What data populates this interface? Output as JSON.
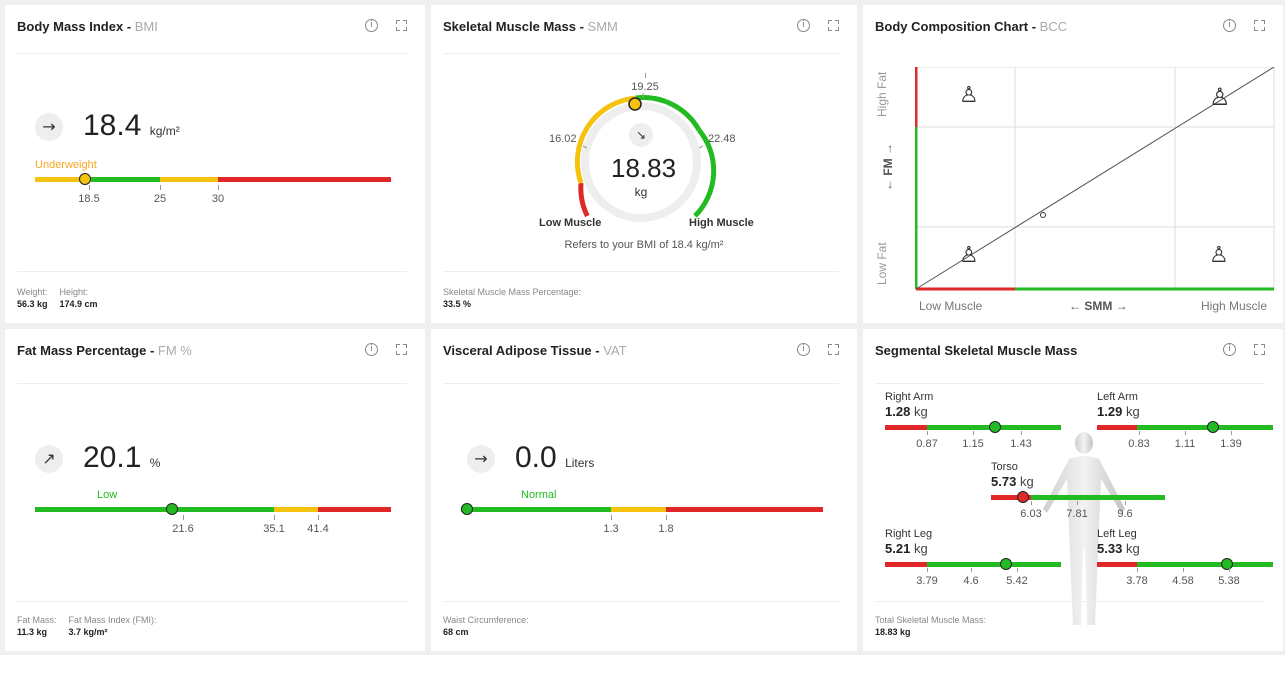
{
  "bmi": {
    "title": "Body Mass Index",
    "abbr": "BMI",
    "trend": "→",
    "value": "18.4",
    "unit": "kg/m²",
    "range_label": "Underweight",
    "ticks": [
      "18.5",
      "25",
      "30"
    ],
    "weight_label": "Weight:",
    "weight": "56.3 kg",
    "height_label": "Height:",
    "height": "174.9 cm",
    "level": 0.14
  },
  "smm": {
    "title": "Skeletal Muscle Mass",
    "abbr": "SMM",
    "value": "18.83",
    "unit": "kg",
    "top": "19.25",
    "left": "16.02",
    "right": "22.48",
    "low_label": "Low Muscle",
    "high_label": "High Muscle",
    "refers": "Refers to your BMI of 18.4 kg/m²",
    "pct_label": "Skeletal Muscle Mass Percentage:",
    "pct": "33.5 %"
  },
  "bcc": {
    "title": "Body Composition Chart",
    "abbr": "BCC",
    "y_high": "High Fat",
    "y_low": "Low Fat",
    "y_axis": "← FM →",
    "x_low": "Low Muscle",
    "x_high": "High Muscle",
    "x_axis": "← SMM →"
  },
  "fm": {
    "title": "Fat Mass Percentage",
    "abbr": "FM %",
    "trend": "↗",
    "value": "20.1",
    "unit": "%",
    "range_label": "Low",
    "ticks": [
      "21.6",
      "35.1",
      "41.4"
    ],
    "mass_label": "Fat Mass:",
    "mass": "11.3 kg",
    "fmi_label": "Fat Mass Index (FMI):",
    "fmi": "3.7 kg/m²"
  },
  "vat": {
    "title": "Visceral Adipose Tissue",
    "abbr": "VAT",
    "trend": "→",
    "value": "0.0",
    "unit": "Liters",
    "range_label": "Normal",
    "ticks": [
      "1.3",
      "1.8"
    ],
    "waist_label": "Waist Circumference:",
    "waist": "68 cm"
  },
  "seg": {
    "title": "Segmental Skeletal Muscle Mass",
    "right_arm": {
      "label": "Right Arm",
      "value": "1.28",
      "unit": "kg",
      "ticks": [
        "0.87",
        "1.15",
        "1.43"
      ]
    },
    "left_arm": {
      "label": "Left Arm",
      "value": "1.29",
      "unit": "kg",
      "ticks": [
        "0.83",
        "1.11",
        "1.39"
      ]
    },
    "torso": {
      "label": "Torso",
      "value": "5.73",
      "unit": "kg",
      "ticks": [
        "6.03",
        "7.81",
        "9.6"
      ]
    },
    "right_leg": {
      "label": "Right Leg",
      "value": "5.21",
      "unit": "kg",
      "ticks": [
        "3.79",
        "4.6",
        "5.42"
      ]
    },
    "left_leg": {
      "label": "Left Leg",
      "value": "5.33",
      "unit": "kg",
      "ticks": [
        "3.78",
        "4.58",
        "5.38"
      ]
    },
    "total_label": "Total Skeletal Muscle Mass:",
    "total": "18.83 kg"
  },
  "colors": {
    "green": "#22bb22",
    "yellow": "#f5c20e",
    "red": "#e02828",
    "orange": "#f5a623"
  }
}
